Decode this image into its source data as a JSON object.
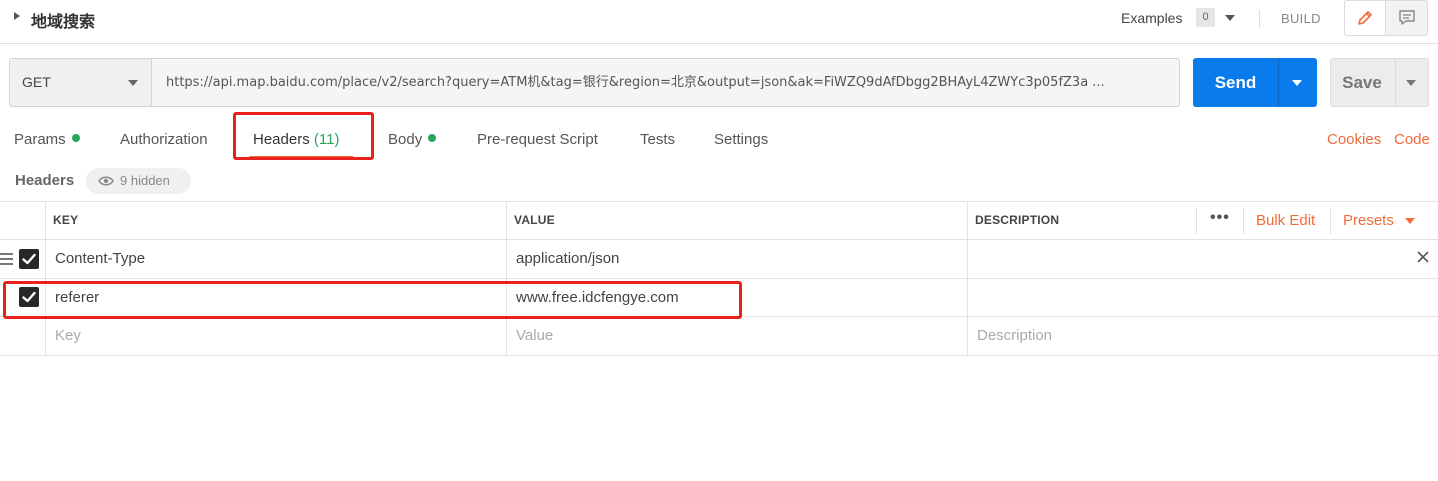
{
  "topbar": {
    "title": "地域搜索",
    "examples_label": "Examples",
    "examples_count": "0",
    "build_label": "BUILD",
    "edit_icon": "pencil-icon",
    "comment_icon": "comment-icon"
  },
  "request": {
    "method": "GET",
    "url": "https://api.map.baidu.com/place/v2/search?query=ATM机&tag=银行&region=北京&output=json&ak=FiWZQ9dAfDbgg2BHAyL4ZWYc3p05fZ3a ...",
    "send_label": "Send",
    "save_label": "Save"
  },
  "tabs": [
    {
      "label": "Params",
      "has_dot": true
    },
    {
      "label": "Authorization",
      "has_dot": false
    },
    {
      "label": "Headers",
      "count": "(11)",
      "active": true
    },
    {
      "label": "Body",
      "has_dot": true
    },
    {
      "label": "Pre-request Script"
    },
    {
      "label": "Tests"
    },
    {
      "label": "Settings"
    }
  ],
  "tab_links": {
    "cookies": "Cookies",
    "code": "Code"
  },
  "headers_section": {
    "label": "Headers",
    "hidden_text": "9 hidden"
  },
  "table": {
    "columns": {
      "key": "KEY",
      "value": "VALUE",
      "description": "DESCRIPTION"
    },
    "more_icon": "more-dots-icon",
    "bulk_edit": "Bulk Edit",
    "presets": "Presets",
    "rows": [
      {
        "checked": true,
        "key": "Content-Type",
        "value": "application/json",
        "description": ""
      },
      {
        "checked": true,
        "key": "referer",
        "value": "www.free.idcfengye.com",
        "description": ""
      }
    ],
    "placeholders": {
      "key": "Key",
      "value": "Value",
      "description": "Description"
    }
  },
  "colors": {
    "accent": "#f26b3a",
    "send": "#097bed",
    "active_dot": "#26a65b",
    "annotation": "#e8201e"
  }
}
